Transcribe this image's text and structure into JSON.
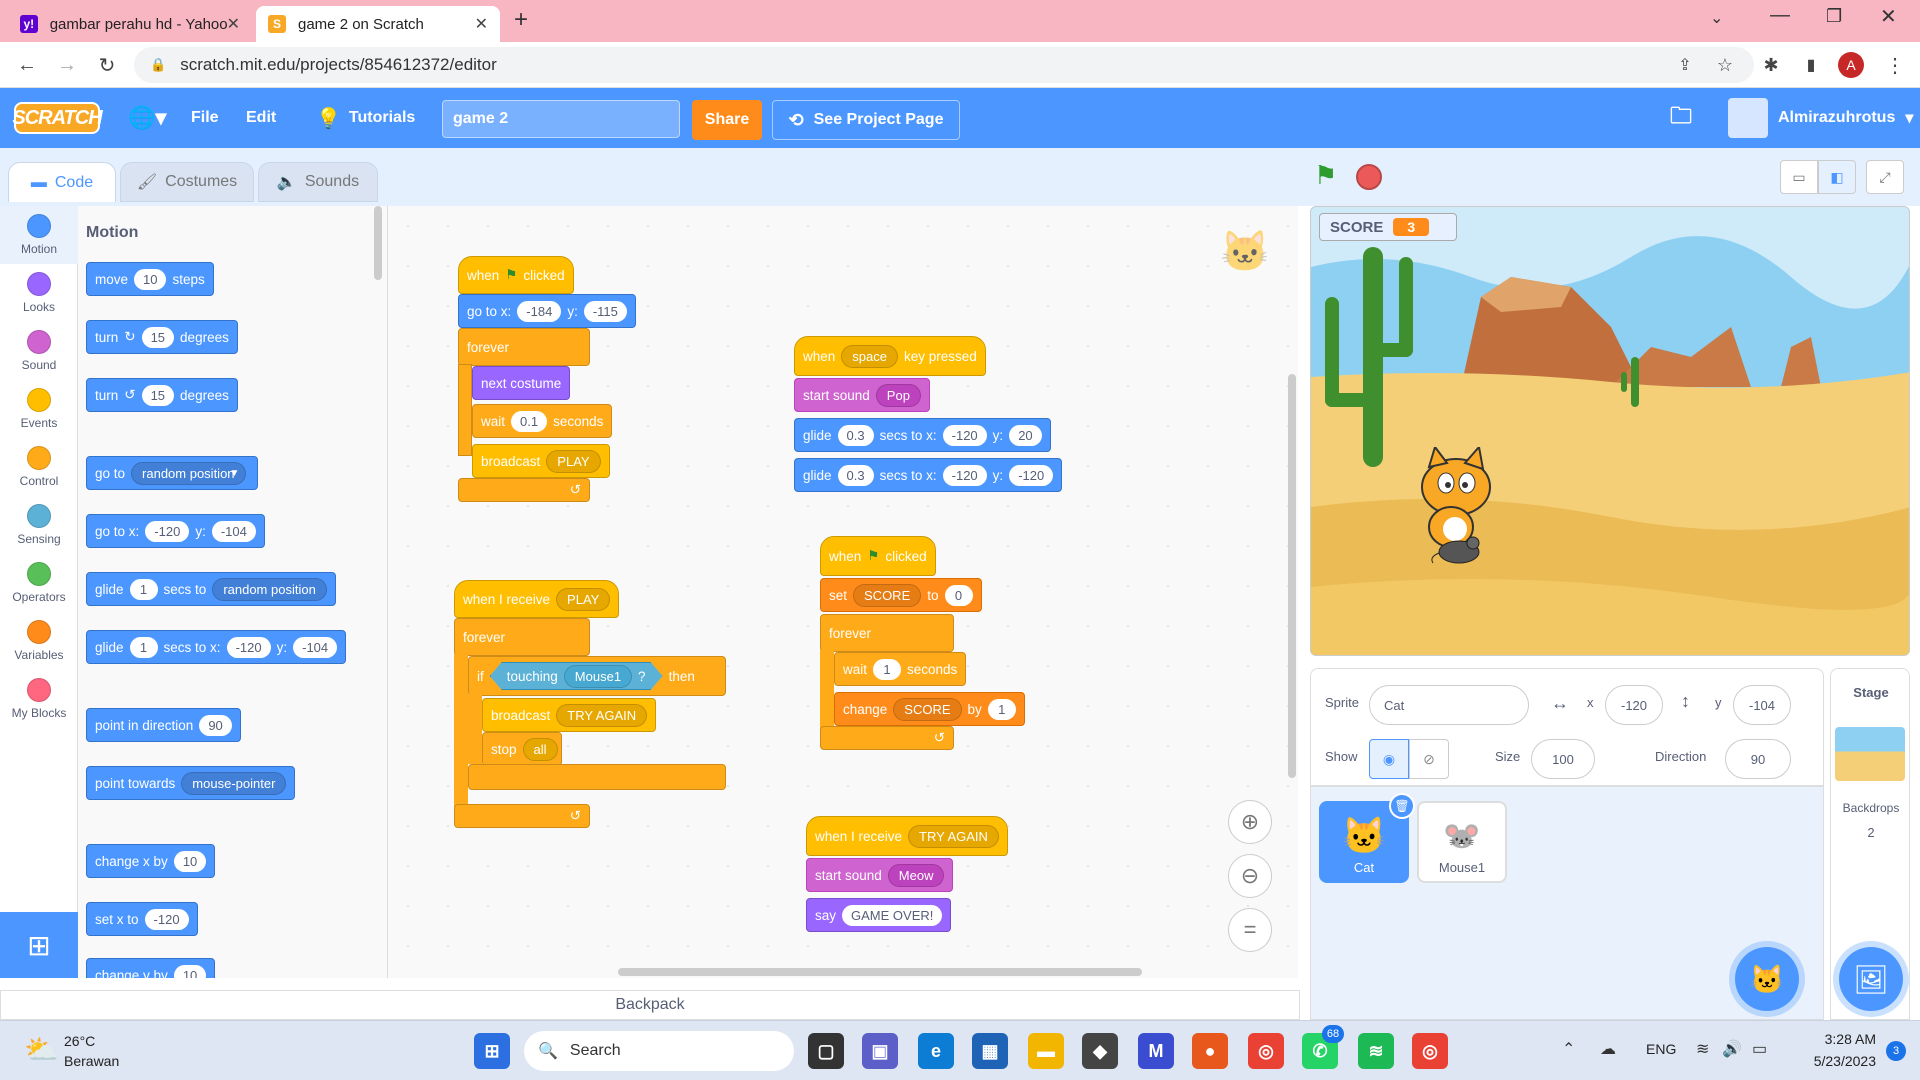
{
  "browser": {
    "tabs": [
      {
        "title": "gambar perahu hd - Yahoo Hasil",
        "favicon": "y!",
        "close": "✕"
      },
      {
        "title": "game 2 on Scratch",
        "favicon": "S",
        "close": "✕"
      }
    ],
    "new_tab": "+",
    "url": "scratch.mit.edu/projects/854612372/editor",
    "profile_initial": "A"
  },
  "menu": {
    "logo": "SCRATCH",
    "file": "File",
    "edit": "Edit",
    "tutorials": "Tutorials",
    "project_title": "game 2",
    "share": "Share",
    "see_project_page": "See Project Page",
    "username": "Almirazuhrotus"
  },
  "editor_tabs": {
    "code": "Code",
    "costumes": "Costumes",
    "sounds": "Sounds"
  },
  "categories": [
    {
      "label": "Motion",
      "color": "#4c97ff"
    },
    {
      "label": "Looks",
      "color": "#9966ff"
    },
    {
      "label": "Sound",
      "color": "#cf63cf"
    },
    {
      "label": "Events",
      "color": "#ffbf00"
    },
    {
      "label": "Control",
      "color": "#ffab19"
    },
    {
      "label": "Sensing",
      "color": "#5cb1d6"
    },
    {
      "label": "Operators",
      "color": "#59c059"
    },
    {
      "label": "Variables",
      "color": "#ff8c1a"
    },
    {
      "label": "My Blocks",
      "color": "#ff6680"
    }
  ],
  "palette": {
    "heading": "Motion",
    "move": {
      "a": "move",
      "v": "10",
      "b": "steps"
    },
    "turn_r": {
      "a": "turn",
      "v": "15",
      "b": "degrees"
    },
    "turn_l": {
      "a": "turn",
      "v": "15",
      "b": "degrees"
    },
    "goto": {
      "a": "go to",
      "dd": "random position"
    },
    "gotoxy": {
      "a": "go to x:",
      "x": "-120",
      "yl": "y:",
      "y": "-104"
    },
    "glide_rand": {
      "a": "glide",
      "v": "1",
      "b": "secs to",
      "dd": "random position"
    },
    "glide_xy": {
      "a": "glide",
      "v": "1",
      "b": "secs to x:",
      "x": "-120",
      "yl": "y:",
      "y": "-104"
    },
    "point_dir": {
      "a": "point in direction",
      "v": "90"
    },
    "point_towards": {
      "a": "point towards",
      "dd": "mouse-pointer"
    },
    "change_x": {
      "a": "change x by",
      "v": "10"
    },
    "set_x": {
      "a": "set x to",
      "v": "-120"
    },
    "change_y": {
      "a": "change y by",
      "v": "10"
    }
  },
  "scripts": {
    "s1": {
      "when": "when",
      "clicked": "clicked",
      "goto": "go to x:",
      "x": "-184",
      "yl": "y:",
      "y": "-115",
      "forever": "forever",
      "next": "next costume",
      "wait": "wait",
      "wait_v": "0.1",
      "seconds": "seconds",
      "broadcast": "broadcast",
      "bc": "PLAY"
    },
    "s2": {
      "recv": "when I receive",
      "msg": "PLAY",
      "forever": "forever",
      "if": "if",
      "touching": "touching",
      "obj": "Mouse1",
      "q": "?",
      "then": "then",
      "broadcast": "broadcast",
      "bc": "TRY AGAIN",
      "stop": "stop",
      "stop_v": "all"
    },
    "s3": {
      "when": "when",
      "key": "space",
      "pressed": "key pressed",
      "sound": "start sound",
      "snd": "Pop",
      "glide": "glide",
      "g1": "0.3",
      "secsx": "secs to x:",
      "x1": "-120",
      "yl": "y:",
      "y1": "20",
      "g2": "0.3",
      "x2": "-120",
      "y2": "-120"
    },
    "s4": {
      "when": "when",
      "clicked": "clicked",
      "set": "set",
      "var": "SCORE",
      "to": "to",
      "val": "0",
      "forever": "forever",
      "wait": "wait",
      "wait_v": "1",
      "seconds": "seconds",
      "change": "change",
      "by": "by",
      "by_v": "1"
    },
    "s5": {
      "recv": "when I receive",
      "msg": "TRY AGAIN",
      "sound": "start sound",
      "snd": "Meow",
      "say": "say",
      "text": "GAME OVER!"
    }
  },
  "backpack": "Backpack",
  "stage": {
    "monitor_label": "SCORE",
    "monitor_value": "3"
  },
  "sprite_info": {
    "sprite_label": "Sprite",
    "sprite_name": "Cat",
    "x_label": "x",
    "x": "-120",
    "y_label": "y",
    "y": "-104",
    "show_label": "Show",
    "size_label": "Size",
    "size": "100",
    "direction_label": "Direction",
    "direction": "90"
  },
  "sprites": [
    {
      "name": "Cat"
    },
    {
      "name": "Mouse1"
    }
  ],
  "stage_panel": {
    "title": "Stage",
    "backdrops_label": "Backdrops",
    "backdrops_count": "2"
  },
  "taskbar": {
    "temp": "26°C",
    "weather": "Berawan",
    "search": "Search",
    "lang": "ENG",
    "time": "3:28 AM",
    "date": "5/23/2023",
    "notif": "3",
    "whatsapp_badge": "68"
  }
}
